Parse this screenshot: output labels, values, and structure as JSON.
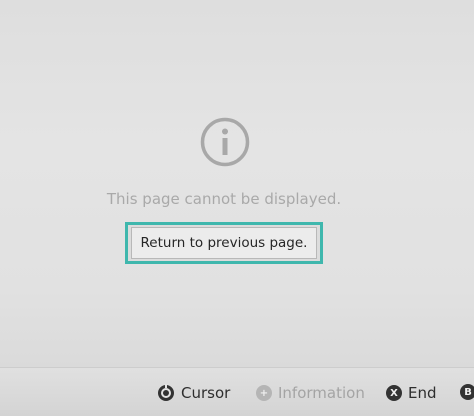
{
  "page": {
    "message": "This page cannot be displayed.",
    "return_button_label": "Return to previous page.",
    "icon": "info-icon"
  },
  "footer": {
    "hints": [
      {
        "icon": "stick-icon",
        "label": "Cursor"
      },
      {
        "icon": "plus-button-icon",
        "glyph": "+",
        "label": "Information"
      },
      {
        "icon": "x-button-icon",
        "glyph": "X",
        "label": "End"
      },
      {
        "icon": "b-button-icon",
        "glyph": "B",
        "label": ""
      }
    ]
  },
  "colors": {
    "accent": "#3fb7ad",
    "background": "#e2e2e2",
    "message_text": "#a9a9a9",
    "button_text": "#262626"
  }
}
